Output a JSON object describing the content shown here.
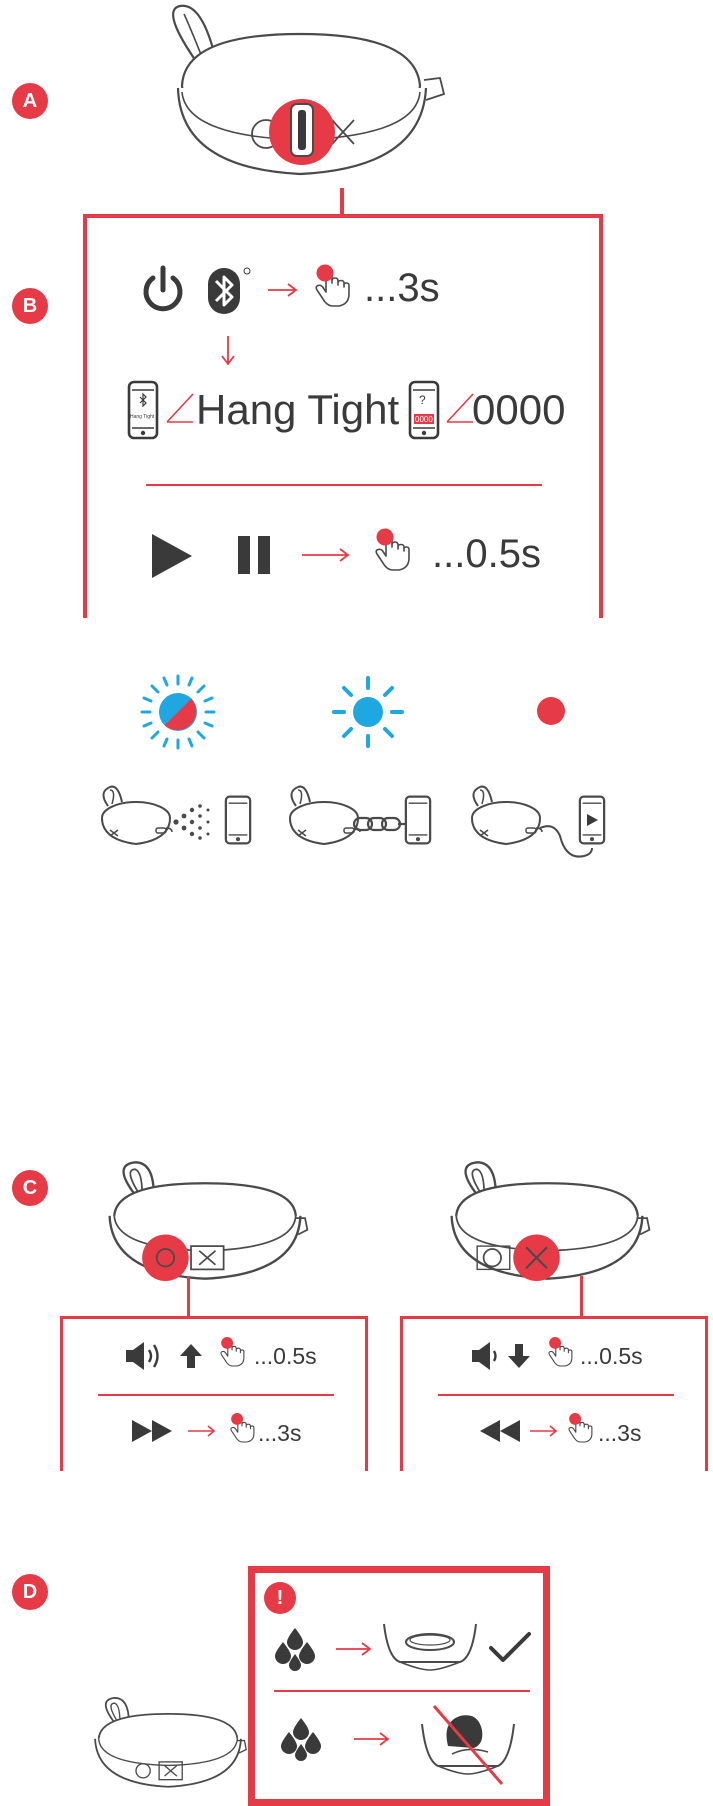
{
  "sections": {
    "a": {
      "badge": "A"
    },
    "b": {
      "badge": "B",
      "pairing_hold": "...3s",
      "phone_screen_text": "Hang Tight",
      "hang_tight": "Hang Tight",
      "pin_screen_question": "?",
      "pin_screen_code": "0000",
      "pin": "0000",
      "play_pause_hold": "...0.5s"
    },
    "c": {
      "badge": "C",
      "left": {
        "volume_hold": "...0.5s",
        "skip_hold": "...3s"
      },
      "right": {
        "volume_hold": "...0.5s",
        "skip_hold": "...3s"
      }
    },
    "d": {
      "badge": "D",
      "warning": "!"
    }
  },
  "colors": {
    "accent_red": "#e63a46",
    "light_blue": "#1fa7e1",
    "line_gray": "#4a4a4a",
    "text_dark": "#3a3a3a"
  },
  "icons": [
    "power-icon",
    "bluetooth-icon",
    "hand-press-icon",
    "phone-icon",
    "play-icon",
    "pause-icon",
    "sun-flashing-icon",
    "sun-solid-icon",
    "red-dot-icon",
    "chain-icon",
    "cable-icon",
    "speaker-icon",
    "volume-up-icon",
    "volume-down-icon",
    "arrow-up-icon",
    "arrow-down-icon",
    "fast-forward-icon",
    "rewind-icon",
    "water-drops-icon",
    "checkmark-icon",
    "cross-out-icon"
  ]
}
